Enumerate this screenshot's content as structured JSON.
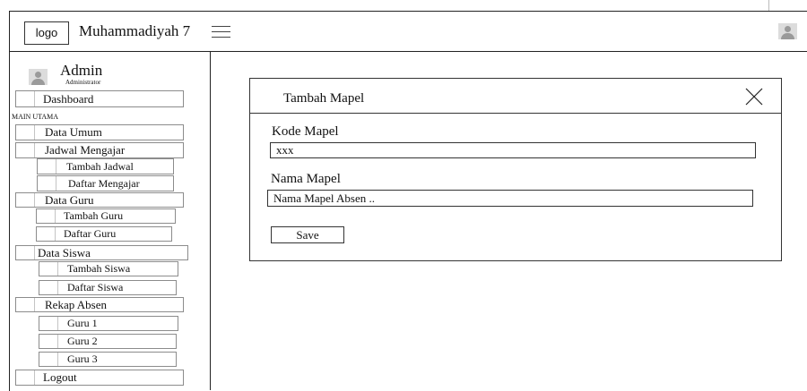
{
  "header": {
    "logo_text": "logo",
    "app_title": "Muhammadiyah 7",
    "menu_icon": "hamburger-menu-icon",
    "avatar_icon": "user-avatar-icon"
  },
  "sidebar": {
    "admin_name": "Admin",
    "admin_role": "Administrator",
    "section_label": "MAIN UTAMA",
    "dashboard": "Dashboard",
    "data_umum": "Data Umum",
    "jadwal_mengajar": "Jadwal Mengajar",
    "tambah_jadwal": "Tambah Jadwal",
    "daftar_mengajar": "Daftar Mengajar",
    "data_guru": "Data Guru",
    "tambah_guru": "Tambah Guru",
    "daftar_guru": "Daftar Guru",
    "data_siswa": "Data Siswa",
    "tambah_siswa": "Tambah Siswa",
    "daftar_siswa": "Daftar Siswa",
    "rekap_absen": "Rekap Absen",
    "guru_1": "Guru 1",
    "guru_2": "Guru 2",
    "guru_3": "Guru 3",
    "logout": "Logout"
  },
  "modal": {
    "title": "Tambah Mapel",
    "close_icon": "close-icon",
    "kode_label": "Kode Mapel",
    "kode_value": "xxx",
    "nama_label": "Nama Mapel",
    "nama_placeholder": "Nama Mapel Absen ..",
    "save_label": "Save"
  }
}
